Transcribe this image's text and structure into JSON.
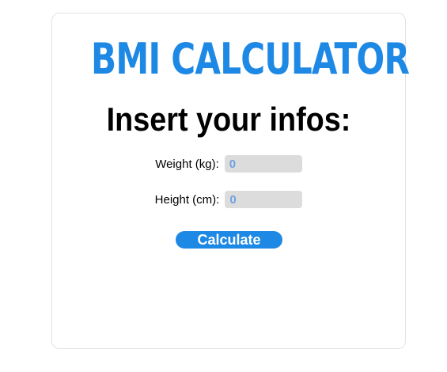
{
  "app": {
    "title": "BMI CALCULATOR",
    "subtitle": "Insert your infos:"
  },
  "form": {
    "weight": {
      "label": "Weight (kg):",
      "value": "",
      "placeholder": "0"
    },
    "height": {
      "label": "Height (cm):",
      "value": "",
      "placeholder": "0"
    },
    "calculate_label": "Calculate"
  },
  "colors": {
    "accent": "#1e88e5",
    "input_background": "#dcdcdc",
    "placeholder_text": "#6fa3dd",
    "card_border": "#e3e3e3"
  }
}
